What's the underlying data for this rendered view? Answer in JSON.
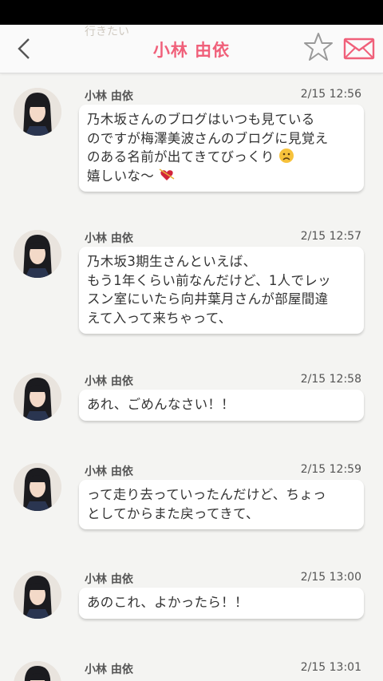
{
  "header": {
    "title": "小林 由依",
    "peek_text": "行きたい"
  },
  "messages": [
    {
      "sender": "小林 由依",
      "time": "2/15 12:56",
      "lines": [
        "乃木坂さんのブログはいつも見ている",
        "のですが梅澤美波さんのブログに見覚え",
        "のある名前が出てきてびっくり",
        "嬉しいな〜"
      ]
    },
    {
      "sender": "小林 由依",
      "time": "2/15 12:57",
      "lines": [
        "乃木坂3期生さんといえば、",
        "もう1年くらい前なんだけど、1人でレッ",
        "スン室にいたら向井葉月さんが部屋間違",
        "えて入って来ちゃって、"
      ]
    },
    {
      "sender": "小林 由依",
      "time": "2/15 12:58",
      "lines": [
        "あれ、ごめんなさい！！"
      ]
    },
    {
      "sender": "小林 由依",
      "time": "2/15 12:59",
      "lines": [
        "って走り去っていったんだけど、ちょっ",
        "としてからまた戻ってきて、"
      ]
    },
    {
      "sender": "小林 由依",
      "time": "2/15 13:00",
      "lines": [
        "あのこれ、よかったら！！"
      ]
    },
    {
      "sender": "小林 由依",
      "time": "2/15 13:01",
      "lines": []
    }
  ],
  "icons": {
    "back": "chevron-left-icon",
    "favorite": "star-outline-icon",
    "mail": "envelope-icon",
    "sad_emoji": "sad-face-icon",
    "heart_emoji": "heart-arrow-icon"
  },
  "colors": {
    "accent": "#f0607a",
    "icon_gray": "#9a9a9a",
    "bubble": "#ffffff",
    "background": "#f4f4f2"
  }
}
